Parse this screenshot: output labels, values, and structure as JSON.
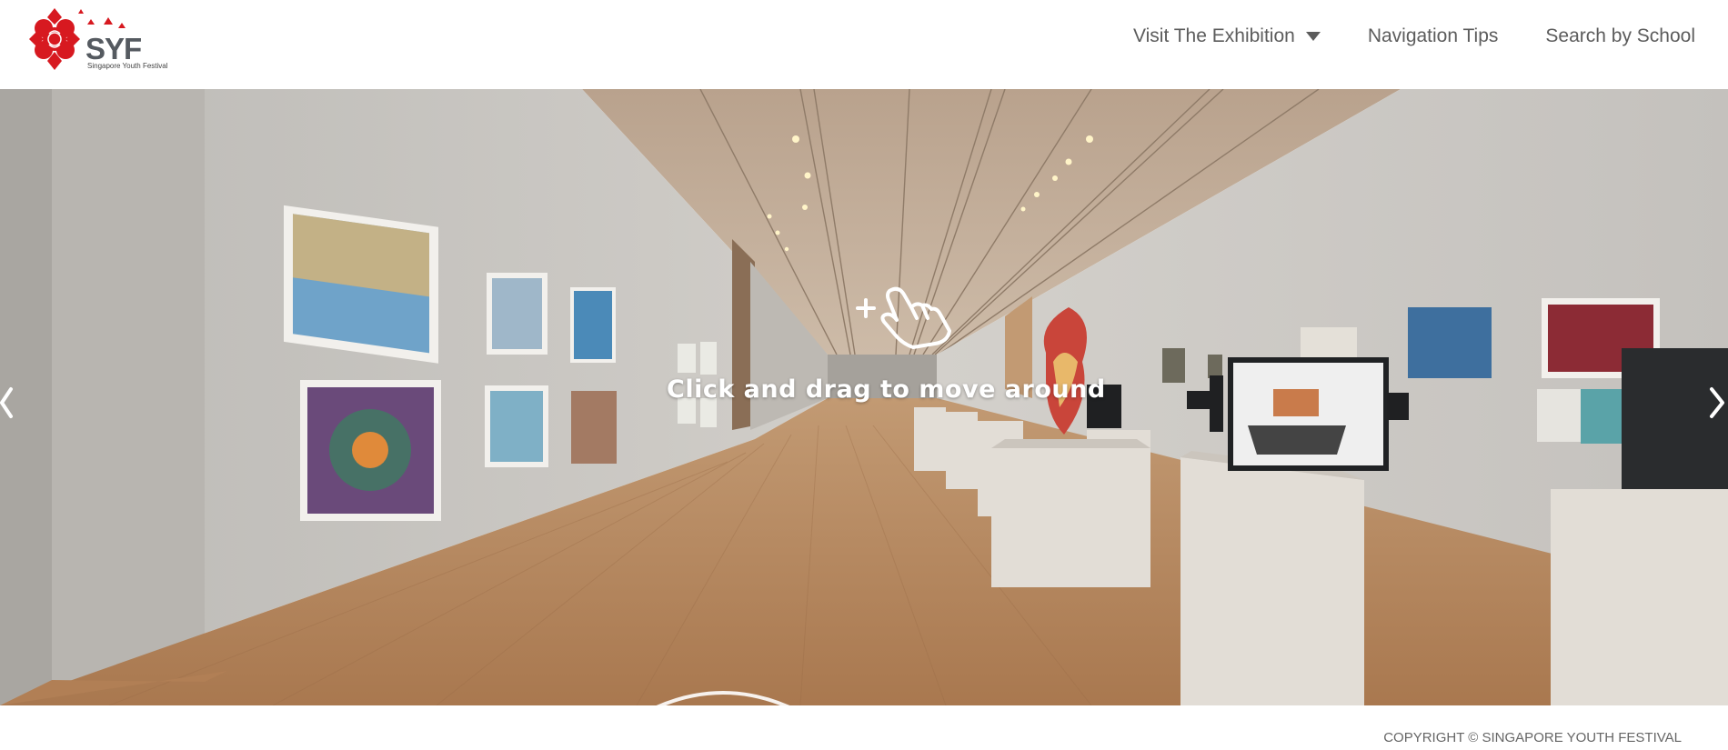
{
  "brand": {
    "logo_text": "SYF",
    "logo_subtitle": "Singapore Youth Festival",
    "brand_color": "#d71920"
  },
  "nav": {
    "items": [
      {
        "label": "Visit The Exhibition",
        "has_dropdown": true
      },
      {
        "label": "Navigation Tips"
      },
      {
        "label": "Search by School"
      }
    ]
  },
  "viewer": {
    "hint_text": "Click and drag to move around",
    "hint_icon": "drag-hand-icon",
    "prev_icon": "chevron-left-icon",
    "next_icon": "chevron-right-icon"
  },
  "footer": {
    "copyright": "COPYRIGHT © SINGAPORE YOUTH FESTIVAL"
  }
}
